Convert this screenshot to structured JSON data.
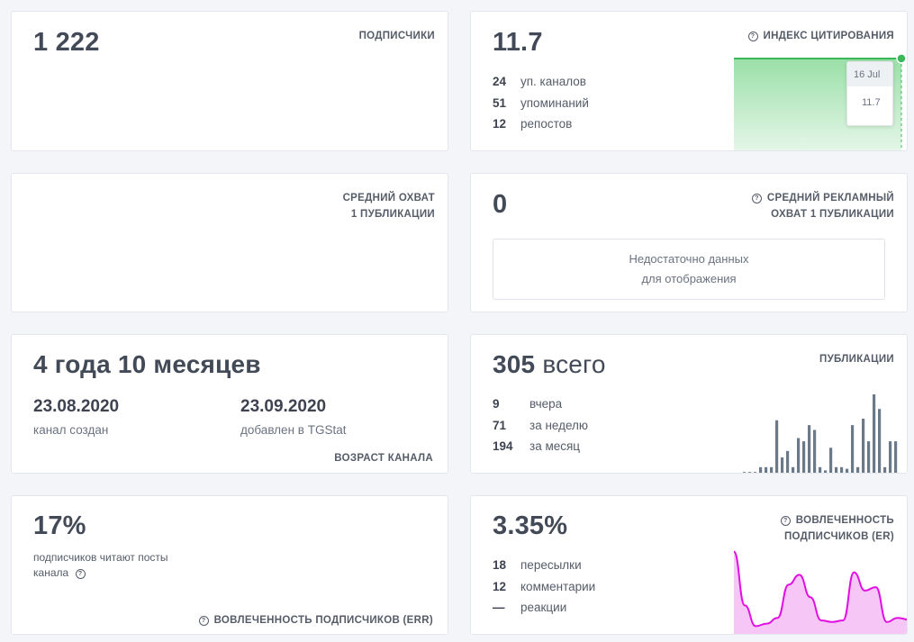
{
  "subscribers": {
    "value": "1 222",
    "label": "ПОДПИСЧИКИ"
  },
  "citation": {
    "value": "11.7",
    "label": "ИНДЕКС ЦИТИРОВАНИЯ",
    "stats": [
      {
        "num": "24",
        "text": "уп. каналов"
      },
      {
        "num": "51",
        "text": "упоминаний"
      },
      {
        "num": "12",
        "text": "репостов"
      }
    ],
    "tooltip": {
      "date": "16 Jul",
      "value": "11.7"
    },
    "chart_color": "#3cb85a"
  },
  "avg_reach": {
    "label_line1": "СРЕДНИЙ ОХВАТ",
    "label_line2": "1 ПУБЛИКАЦИИ"
  },
  "ad_reach": {
    "value": "0",
    "label_line1": "СРЕДНИЙ РЕКЛАМНЫЙ",
    "label_line2": "ОХВАТ 1 ПУБЛИКАЦИИ",
    "empty_line1": "Недостаточно данных",
    "empty_line2": "для отображения"
  },
  "age": {
    "value": "4 года 10 месяцев",
    "created_date": "23.08.2020",
    "created_label": "канал создан",
    "added_date": "23.09.2020",
    "added_label": "добавлен в TGStat",
    "label": "ВОЗРАСТ КАНАЛА"
  },
  "posts": {
    "value_num": "305",
    "value_suffix": "всего",
    "label": "ПУБЛИКАЦИИ",
    "stats": [
      {
        "num": "9",
        "text": "вчера"
      },
      {
        "num": "71",
        "text": "за неделю"
      },
      {
        "num": "194",
        "text": "за месяц"
      }
    ],
    "bars": [
      1,
      1,
      1,
      4,
      4,
      4,
      33,
      10,
      14,
      4,
      22,
      20,
      30,
      27,
      4,
      2,
      16,
      4,
      4,
      3,
      30,
      4,
      34,
      20,
      49,
      40,
      4,
      20,
      20
    ],
    "bar_color": "#6b7a8a"
  },
  "err": {
    "value": "17%",
    "desc_line1": "подписчиков читают посты",
    "desc_line2": "канала",
    "label": "ВОВЛЕЧЕННОСТЬ ПОДПИСЧИКОВ (ERR)"
  },
  "er": {
    "value": "3.35%",
    "label_line1": "ВОВЛЕЧЕННОСТЬ",
    "label_line2": "ПОДПИСЧИКОВ (ER)",
    "stats": [
      {
        "num": "18",
        "text": "пересылки"
      },
      {
        "num": "12",
        "text": "комментарии"
      },
      {
        "num": "—",
        "text": "реакции"
      }
    ],
    "chart_color": "#e010e0",
    "series": [
      0.95,
      0.3,
      0.05,
      0.08,
      0.15,
      0.55,
      0.67,
      0.4,
      0.12,
      0.1,
      0.12,
      0.7,
      0.48,
      0.52,
      0.1,
      0.15,
      0.13
    ]
  }
}
